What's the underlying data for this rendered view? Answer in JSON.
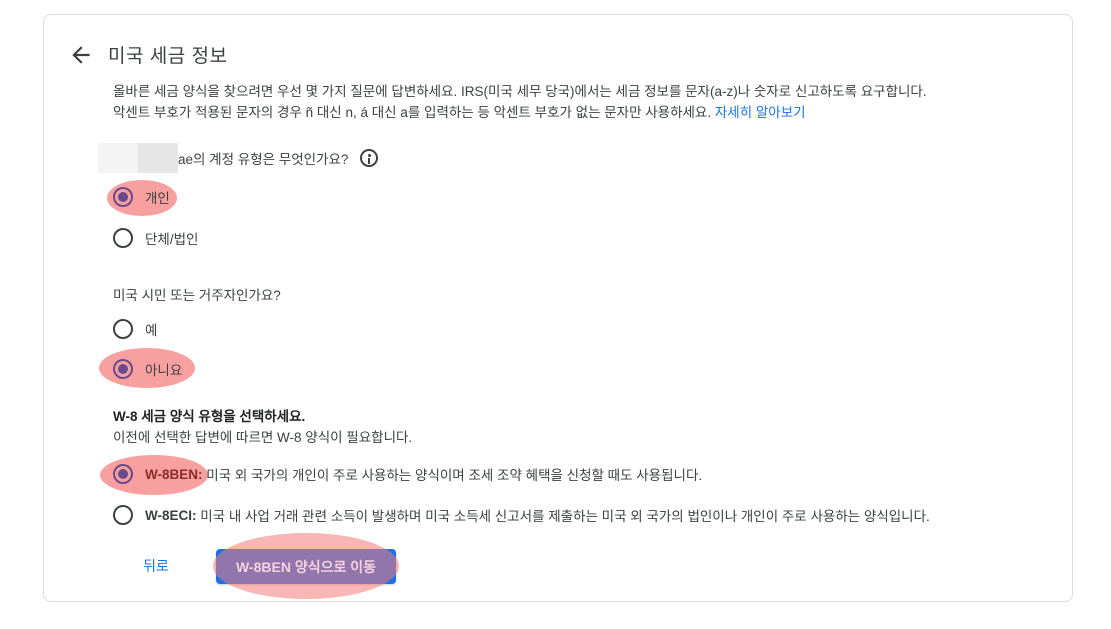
{
  "header": {
    "title": "미국 세금 정보",
    "back_icon": "arrow-left-icon"
  },
  "intro": {
    "line1": "올바른 세금 양식을 찾으려면 우선 몇 가지 질문에 답변하세요. IRS(미국 세무 당국)에서는 세금 정보를 문자(a-z)나 숫자로 신고하도록 요구합니다.",
    "line2": "악센트 부호가 적용된 문자의 경우 ñ 대신 n, á 대신 a를 입력하는 등 악센트 부호가 없는 문자만 사용하세요.",
    "learn_more": "자세히 알아보기"
  },
  "question1": {
    "label": "ae의 계정 유형은 무엇인가요?",
    "info_icon": "info-icon",
    "options": [
      {
        "label": "개인",
        "selected": true
      },
      {
        "label": "단체/법인",
        "selected": false
      }
    ]
  },
  "question2": {
    "label": "미국 시민 또는 거주자인가요?",
    "options": [
      {
        "label": "예",
        "selected": false
      },
      {
        "label": "아니요",
        "selected": true
      }
    ]
  },
  "question3": {
    "title": "W-8 세금 양식 유형을 선택하세요.",
    "subtitle": "이전에 선택한 답변에 따르면 W-8 양식이 필요합니다.",
    "options": [
      {
        "code": "W-8BEN:",
        "text": " 미국 외 국가의 개인이 주로 사용하는 양식이며 조세 조약 혜택을 신청할 때도 사용됩니다.",
        "selected": true
      },
      {
        "code": "W-8ECI:",
        "text": " 미국 내 사업 거래 관련 소득이 발생하며 미국 소득세 신고서를 제출하는 미국 외 국가의 법인이나 개인이 주로 사용하는 양식입니다.",
        "selected": false
      }
    ]
  },
  "actions": {
    "back_label": "뒤로",
    "primary_label": "W-8BEN 양식으로 이동"
  },
  "colors": {
    "accent": "#1a73e8",
    "highlight": "#f57878",
    "radio_selected": "#6a4a8a"
  }
}
